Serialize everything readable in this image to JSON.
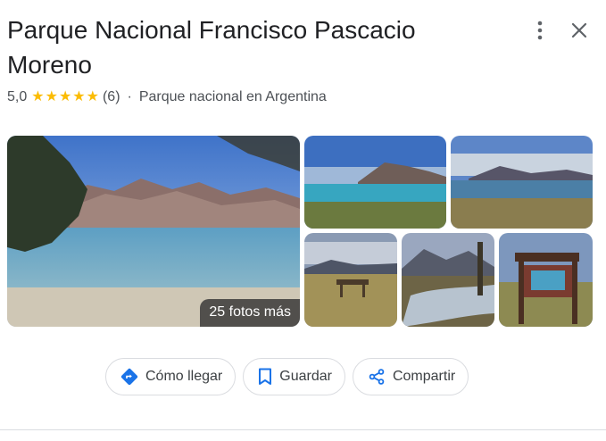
{
  "title": "Parque Nacional Francisco Pascacio Moreno",
  "rating": {
    "value": "5,0",
    "stars": 5,
    "count": "(6)"
  },
  "separator": "·",
  "category": "Parque nacional en Argentina",
  "gallery": {
    "more_label": "25 fotos más",
    "photos": [
      "lake-mountains",
      "lake-island",
      "lake-clouds",
      "bench-field",
      "mountain-stream",
      "info-sign"
    ]
  },
  "actions": [
    {
      "label": "Cómo llegar",
      "icon": "directions-icon"
    },
    {
      "label": "Guardar",
      "icon": "bookmark-icon"
    },
    {
      "label": "Compartir",
      "icon": "share-icon"
    }
  ],
  "colors": {
    "star": "#fbbc04",
    "directions": "#1a73e8",
    "icon": "#1a73e8"
  }
}
